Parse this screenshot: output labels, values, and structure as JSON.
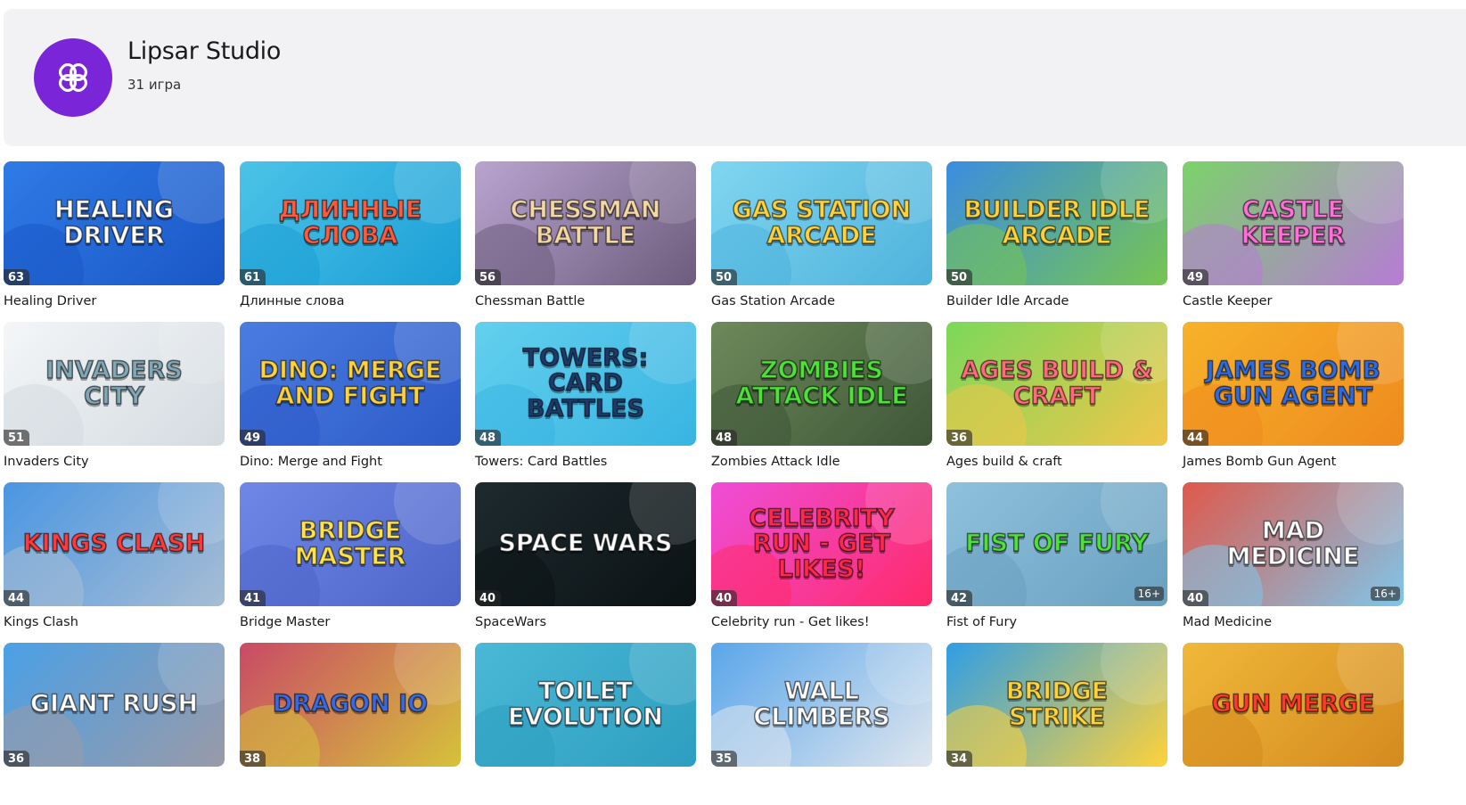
{
  "developer": {
    "name": "Lipsar Studio",
    "games_count": "31 игра",
    "avatar_icon": "knot-logo-icon",
    "avatar_color": "#7b25d8"
  },
  "games": [
    {
      "title": "Healing Driver",
      "thumb_text": "Healing Driver",
      "rating": "63",
      "bg": "#2f7be6",
      "bg2": "#1a57c6",
      "text_color": "#ffffff"
    },
    {
      "title": "Длинные слова",
      "thumb_text": "Длинные слова",
      "rating": "61",
      "bg": "#4cc3e8",
      "bg2": "#1b9fd6",
      "text_color": "#ff5a3c"
    },
    {
      "title": "Chessman Battle",
      "thumb_text": "Chessman Battle",
      "rating": "56",
      "bg": "#b9a4cf",
      "bg2": "#6d5c7d",
      "text_color": "#f3d7a4"
    },
    {
      "title": "Gas Station Arcade",
      "thumb_text": "Gas Station Arcade",
      "rating": "50",
      "bg": "#7fd6f0",
      "bg2": "#4fb2dc",
      "text_color": "#ffd23a"
    },
    {
      "title": "Builder Idle Arcade",
      "thumb_text": "Builder Idle Arcade",
      "rating": "50",
      "bg": "#3a8de0",
      "bg2": "#77c552",
      "text_color": "#ffd23a"
    },
    {
      "title": "Castle Keeper",
      "thumb_text": "Castle Keeper",
      "rating": "49",
      "bg": "#7bd36a",
      "bg2": "#b77bd6",
      "text_color": "#ff6fd6"
    },
    {
      "title": "Invaders City",
      "thumb_text": "Invaders City",
      "rating": "51",
      "bg": "#f4f6f8",
      "bg2": "#d4dbe0",
      "text_color": "#7fa7b6"
    },
    {
      "title": "Dino: Merge and Fight",
      "thumb_text": "Dino: Merge and Fight",
      "rating": "49",
      "bg": "#4a7de0",
      "bg2": "#2c5ac8",
      "text_color": "#ffd23a"
    },
    {
      "title": "Towers: Card Battles",
      "thumb_text": "Towers: Card Battles",
      "rating": "48",
      "bg": "#63d0ee",
      "bg2": "#38b4e2",
      "text_color": "#1f3a6a"
    },
    {
      "title": "Zombies Attack Idle",
      "thumb_text": "Zombies Attack Idle",
      "rating": "48",
      "bg": "#6d8a5a",
      "bg2": "#3f5638",
      "text_color": "#4fe03a"
    },
    {
      "title": "Ages build & craft",
      "thumb_text": "Ages build & craft",
      "rating": "36",
      "bg": "#7bd85a",
      "bg2": "#f1c64a",
      "text_color": "#ff6a7c"
    },
    {
      "title": "James Bomb Gun Agent",
      "thumb_text": "James Bomb Gun Agent",
      "rating": "44",
      "bg": "#f7b22a",
      "bg2": "#ee8a1e",
      "text_color": "#2f6be0"
    },
    {
      "title": "Kings Clash",
      "thumb_text": "Kings Clash",
      "rating": "44",
      "bg": "#4a96e2",
      "bg2": "#a7bdd4",
      "text_color": "#ff3a3a"
    },
    {
      "title": "Bridge Master",
      "thumb_text": "Bridge Master",
      "rating": "41",
      "bg": "#6f88e6",
      "bg2": "#4d65c8",
      "text_color": "#ffe24a"
    },
    {
      "title": "SpaceWars",
      "thumb_text": "Space Wars",
      "rating": "40",
      "bg": "#1e2a2e",
      "bg2": "#0b1214",
      "text_color": "#ffffff"
    },
    {
      "title": "Celebrity run - Get likes!",
      "thumb_text": "Celebrity Run - Get likes!",
      "rating": "40",
      "bg": "#ee4ed8",
      "bg2": "#ff2a6a",
      "text_color": "#ff2a4a"
    },
    {
      "title": "Fist of Fury",
      "thumb_text": "Fist of Fury",
      "rating": "42",
      "bg": "#8ec1dc",
      "bg2": "#6aa0c0",
      "text_color": "#4fe03a",
      "age": "16+"
    },
    {
      "title": "Mad Medicine",
      "thumb_text": "Mad Medicine",
      "rating": "40",
      "bg": "#e0584a",
      "bg2": "#7fc6ea",
      "text_color": "#ffffff",
      "age": "16+"
    },
    {
      "title": "",
      "thumb_text": "Giant Rush",
      "rating": "36",
      "bg": "#4aa0e6",
      "bg2": "#9a9aa8",
      "text_color": "#ffffff"
    },
    {
      "title": "",
      "thumb_text": "Dragon IO",
      "rating": "38",
      "bg": "#c94a66",
      "bg2": "#d6c23a",
      "text_color": "#3a6ae0"
    },
    {
      "title": "",
      "thumb_text": "Toilet Evolution",
      "rating": "",
      "bg": "#4ab8d6",
      "bg2": "#2e9ec0",
      "text_color": "#ffffff"
    },
    {
      "title": "",
      "thumb_text": "Wall Climbers",
      "rating": "35",
      "bg": "#5aa6ea",
      "bg2": "#dfe6ee",
      "text_color": "#ffffff"
    },
    {
      "title": "",
      "thumb_text": "Bridge Strike",
      "rating": "34",
      "bg": "#2f9ee6",
      "bg2": "#ffd23a",
      "text_color": "#ffd23a"
    },
    {
      "title": "",
      "thumb_text": "Gun Merge",
      "rating": "",
      "bg": "#f0b83a",
      "bg2": "#d48a1e",
      "text_color": "#ff3a2a"
    }
  ]
}
